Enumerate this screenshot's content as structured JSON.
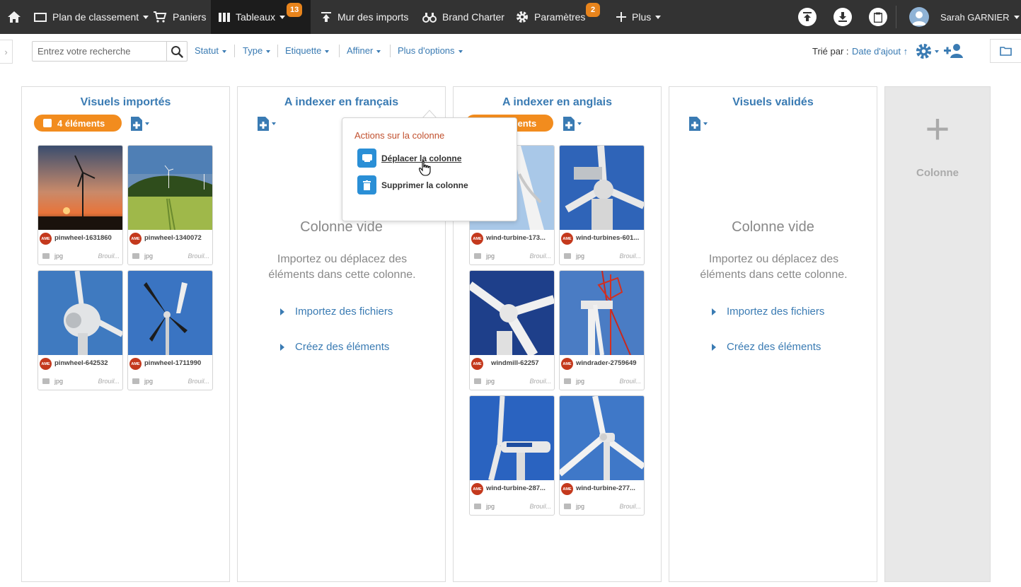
{
  "nav": {
    "home": "home-icon",
    "items": [
      {
        "label": "Plan de classement"
      },
      {
        "label": "Paniers"
      },
      {
        "label": "Tableaux",
        "badge": "13"
      },
      {
        "label": "Mur des imports"
      },
      {
        "label": "Brand Charter"
      },
      {
        "label": "Paramètres",
        "badge": "2"
      },
      {
        "label": "Plus"
      }
    ],
    "user": "Sarah GARNIER"
  },
  "toolbar": {
    "search_placeholder": "Entrez votre recherche",
    "filters": [
      "Statut",
      "Type",
      "Etiquette",
      "Affiner",
      "Plus d'options"
    ],
    "sort_label": "Trié par :",
    "sort_value": "Date d'ajout ↑"
  },
  "columns": [
    {
      "title": "Visuels importés",
      "count_label": "4 éléments",
      "cards": [
        {
          "name": "pinwheel-1631860",
          "type": "jpg",
          "status": "Brouil...",
          "owner": "AME"
        },
        {
          "name": "pinwheel-1340072",
          "type": "jpg",
          "status": "Brouil...",
          "owner": "AME"
        },
        {
          "name": "pinwheel-642532",
          "type": "jpg",
          "status": "Brouil...",
          "owner": "AME"
        },
        {
          "name": "pinwheel-1711990",
          "type": "jpg",
          "status": "Brouil...",
          "owner": "AME"
        }
      ]
    },
    {
      "title": "A indexer en français",
      "empty_title": "Colonne vide",
      "empty_desc": "Importez ou déplacez des éléments dans cette colonne.",
      "link_import": "Importez des fichiers",
      "link_create": "Créez des éléments"
    },
    {
      "title": "A indexer en anglais",
      "count_label": "6 éléments",
      "cards": [
        {
          "name": "wind-turbine-173...",
          "type": "jpg",
          "status": "Brouil...",
          "owner": "AME"
        },
        {
          "name": "wind-turbines-601...",
          "type": "jpg",
          "status": "Brouil...",
          "owner": "AME"
        },
        {
          "name": "windmill-62257",
          "type": "jpg",
          "status": "Brouil...",
          "owner": "AME"
        },
        {
          "name": "windrader-2759649",
          "type": "jpg",
          "status": "Brouil...",
          "owner": "AME"
        },
        {
          "name": "wind-turbine-287...",
          "type": "jpg",
          "status": "Brouil...",
          "owner": "AME"
        },
        {
          "name": "wind-turbine-277...",
          "type": "jpg",
          "status": "Brouil...",
          "owner": "AME"
        }
      ]
    },
    {
      "title": "Visuels validés",
      "empty_title": "Colonne vide",
      "empty_desc": "Importez ou déplacez des éléments dans cette colonne.",
      "link_import": "Importez des fichiers",
      "link_create": "Créez des éléments"
    }
  ],
  "add_column_label": "Colonne",
  "popover": {
    "title": "Actions sur la colonne",
    "move": "Déplacer la colonne",
    "delete": "Supprimer la colonne"
  },
  "colors": {
    "topbar": "#333333",
    "accent_blue": "#3a7bb3",
    "badge_orange": "#e8841c",
    "pill_orange": "#f28c1e",
    "popover_title": "#c1502e"
  }
}
